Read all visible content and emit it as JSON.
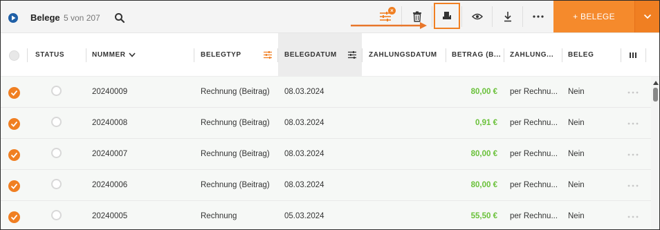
{
  "toolbar": {
    "title": "Belege",
    "count": "5 von 207",
    "filter_badge": "×",
    "new_button_label": "+ BELEGE"
  },
  "columns": {
    "status": "STATUS",
    "nummer": "NUMMER",
    "belegtyp": "BELEGTYP",
    "belegdatum": "BELEGDATUM",
    "zahlungsdatum": "ZAHLUNGSDATUM",
    "betrag": "BETRAG (B...",
    "zahlung": "ZAHLUNG...",
    "beleg": "BELEG"
  },
  "rows": [
    {
      "nummer": "20240009",
      "belegtyp": "Rechnung (Beitrag)",
      "belegdatum": "08.03.2024",
      "zahlungsdatum": "",
      "betrag": "80,00 €",
      "zahlung": "per Rechnu...",
      "beleg": "Nein"
    },
    {
      "nummer": "20240008",
      "belegtyp": "Rechnung (Beitrag)",
      "belegdatum": "08.03.2024",
      "zahlungsdatum": "",
      "betrag": "0,91 €",
      "zahlung": "per Rechnu...",
      "beleg": "Nein"
    },
    {
      "nummer": "20240007",
      "belegtyp": "Rechnung (Beitrag)",
      "belegdatum": "08.03.2024",
      "zahlungsdatum": "",
      "betrag": "80,00 €",
      "zahlung": "per Rechnu...",
      "beleg": "Nein"
    },
    {
      "nummer": "20240006",
      "belegtyp": "Rechnung (Beitrag)",
      "belegdatum": "08.03.2024",
      "zahlungsdatum": "",
      "betrag": "80,00 €",
      "zahlung": "per Rechnu...",
      "beleg": "Nein"
    },
    {
      "nummer": "20240005",
      "belegtyp": "Rechnung",
      "belegdatum": "05.03.2024",
      "zahlungsdatum": "",
      "betrag": "55,50 €",
      "zahlung": "per Rechnu...",
      "beleg": "Nein"
    }
  ],
  "colors": {
    "accent": "#f07f22",
    "amount": "#6ac13a",
    "app_icon": "#1f5fa6"
  }
}
